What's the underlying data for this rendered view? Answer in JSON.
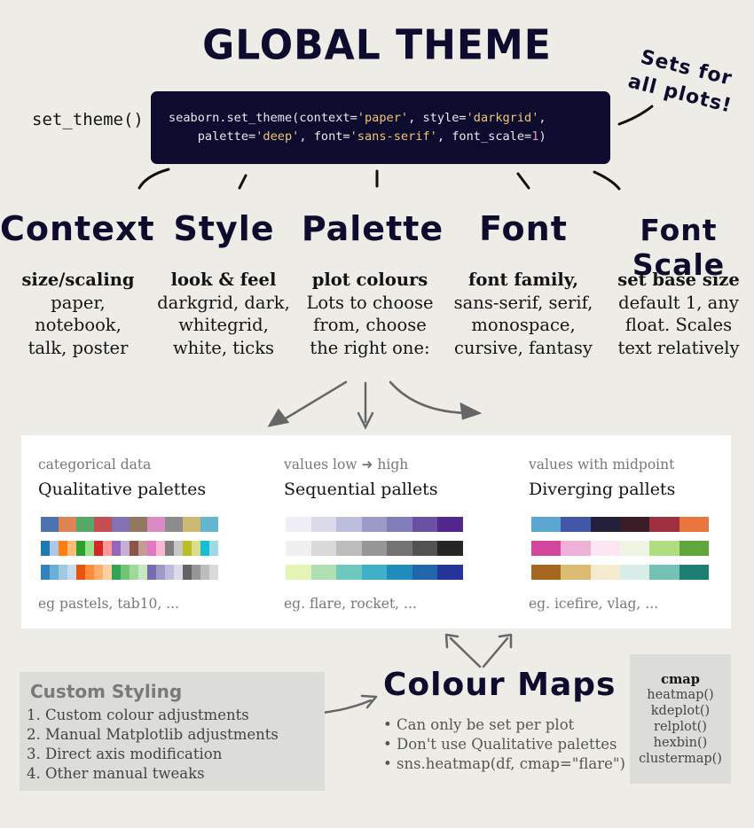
{
  "title": "GLOBAL THEME",
  "sets_note": "Sets for all plots!",
  "set_theme_label": "set_theme()",
  "code": {
    "line1_pre": "seaborn.set_theme(context=",
    "line1_ctx": "'paper'",
    "line1_mid": ", style=",
    "line1_style": "'darkgrid'",
    "line1_end": ",",
    "line2_pre": "    palette=",
    "line2_pal": "'deep'",
    "line2_mid": ", font=",
    "line2_font": "'sans-serif'",
    "line2_mid2": ", font_scale=",
    "line2_num": "1",
    "line2_end": ")"
  },
  "categories": [
    {
      "title": "Context",
      "head": "size/scaling",
      "lines": [
        "paper,",
        "notebook,",
        "talk, poster"
      ]
    },
    {
      "title": "Style",
      "head": "look & feel",
      "lines": [
        "darkgrid, dark,",
        "whitegrid,",
        "white, ticks"
      ]
    },
    {
      "title": "Palette",
      "head": "plot colours",
      "lines": [
        "Lots to choose",
        "from, choose",
        "the right one:"
      ]
    },
    {
      "title": "Font",
      "head": "font family,",
      "lines": [
        "sans-serif, serif,",
        "monospace,",
        "cursive, fantasy"
      ]
    },
    {
      "title": "Font Scale",
      "head": "set base size",
      "lines": [
        "default 1, any",
        "float. Scales",
        "text relatively"
      ]
    }
  ],
  "palettes": [
    {
      "caption": "categorical data",
      "title": "Qualitative palettes",
      "footer": "eg pastels, tab10, ...",
      "rows": [
        [
          "#4c72b0",
          "#dd8452",
          "#55a868",
          "#c44e52",
          "#8172b3",
          "#937860",
          "#da8bc3",
          "#8c8c8c",
          "#ccb974",
          "#64b5cd"
        ],
        [
          "#1f77b4",
          "#aec7e8",
          "#ff7f0e",
          "#ffbb78",
          "#2ca02c",
          "#98df8a",
          "#d62728",
          "#ff9896",
          "#9467bd",
          "#c5b0d5",
          "#8c564b",
          "#c49c94",
          "#e377c2",
          "#f7b6d2",
          "#7f7f7f",
          "#c7c7c7",
          "#bcbd22",
          "#dbdb8d",
          "#17becf",
          "#9edae5"
        ],
        [
          "#3182bd",
          "#6baed6",
          "#9ecae1",
          "#c6dbef",
          "#e6550d",
          "#fd8d3c",
          "#fdae6b",
          "#fdd0a2",
          "#31a354",
          "#74c476",
          "#a1d99b",
          "#c7e9c0",
          "#756bb1",
          "#9e9ac8",
          "#bcbddc",
          "#dadaeb",
          "#636363",
          "#969696",
          "#bdbdbd",
          "#d9d9d9"
        ]
      ]
    },
    {
      "caption": "values low  ➜ high",
      "title": "Sequential pallets",
      "footer": "eg. flare, rocket, ...",
      "rows": [
        [
          "#efedf5",
          "#dadaeb",
          "#bcbddc",
          "#9e9ac8",
          "#807dba",
          "#6a51a3",
          "#54278f"
        ],
        [
          "#f0f0f0",
          "#d9d9d9",
          "#bdbdbd",
          "#969696",
          "#737373",
          "#525252",
          "#252525"
        ],
        [
          "#e3f4b4",
          "#b0dfb4",
          "#6ec8bf",
          "#3fb0c8",
          "#1f8cbd",
          "#2166ac",
          "#25349a"
        ]
      ]
    },
    {
      "caption": "values with midpoint",
      "title": "Diverging pallets",
      "footer": "eg. icefire, vlag, ...",
      "rows": [
        [
          "#5ba6d1",
          "#4357a8",
          "#25203a",
          "#3a1c28",
          "#9e2f3f",
          "#e8763e"
        ],
        [
          "#d2469c",
          "#efb0d6",
          "#fbe6f1",
          "#eef5e2",
          "#aede7e",
          "#5ea73a"
        ],
        [
          "#a6671f",
          "#dbbb72",
          "#f5ebcf",
          "#d6ede8",
          "#74c2b3",
          "#1d7e74"
        ]
      ]
    }
  ],
  "custom_styling": {
    "title": "Custom Styling",
    "items": [
      "1. Custom colour adjustments",
      "2. Manual Matplotlib adjustments",
      "3. Direct axis modification",
      "4. Other manual tweaks"
    ]
  },
  "colour_maps": {
    "title": "Colour Maps",
    "bullets": [
      "• Can only be set per plot",
      "• Don't use Qualitative palettes",
      "• sns.heatmap(df, cmap=\"flare\")"
    ]
  },
  "cmap_box": {
    "title": "cmap",
    "items": [
      "heatmap()",
      "kdeplot()",
      "relplot()",
      "hexbin()",
      "clustermap()"
    ]
  }
}
